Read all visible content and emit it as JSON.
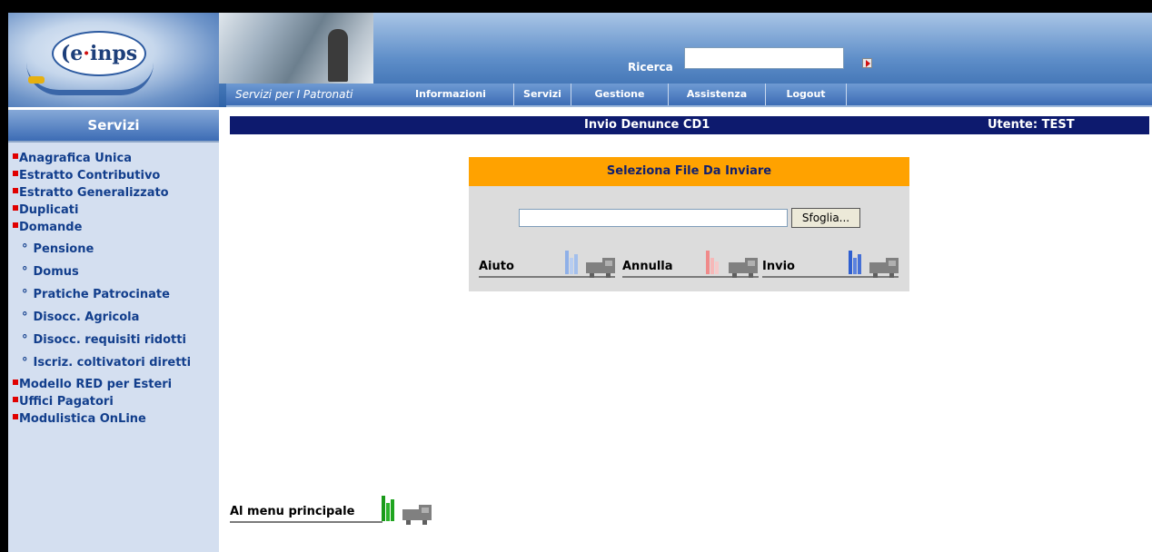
{
  "header": {
    "logo_text": "e-inps",
    "tagline": "Servizi per I Patronati",
    "search_label": "Ricerca",
    "search_value": "",
    "nav": [
      "Informazioni",
      "Servizi",
      "Gestione",
      "Assistenza",
      "Logout"
    ]
  },
  "sidebar": {
    "title": "Servizi",
    "items": [
      {
        "label": "Anagrafica Unica",
        "level": 1
      },
      {
        "label": "Estratto Contributivo",
        "level": 1
      },
      {
        "label": "Estratto Generalizzato",
        "level": 1
      },
      {
        "label": "Duplicati",
        "level": 1
      },
      {
        "label": "Domande",
        "level": 1
      },
      {
        "label": "Pensione",
        "level": 2
      },
      {
        "label": "Domus",
        "level": 2
      },
      {
        "label": "Pratiche Patrocinate",
        "level": 2
      },
      {
        "label": "Disocc. Agricola",
        "level": 2
      },
      {
        "label": "Disocc. requisiti ridotti",
        "level": 2
      },
      {
        "label": "Iscriz. coltivatori diretti",
        "level": 2
      },
      {
        "label": "Modello RED per Esteri",
        "level": 1
      },
      {
        "label": "Uffici Pagatori",
        "level": 1
      },
      {
        "label": "Modulistica OnLine",
        "level": 1
      }
    ]
  },
  "titlebar": {
    "title": "Invio Denunce CD1",
    "user": "Utente: TEST"
  },
  "upload": {
    "heading": "Seleziona File Da Inviare",
    "file_value": "",
    "browse_label": "Sfoglia...",
    "actions": [
      "Aiuto",
      "Annulla",
      "Invio"
    ]
  },
  "footer": {
    "back_label": "Al menu principale"
  },
  "colors": {
    "titlebar": "#0d1a6e",
    "panel_header": "#ffa200",
    "sidebar_bg": "#d4dff0",
    "link": "#123e8c",
    "bullet": "#e00000",
    "aiuto_icon": "#8fb0e8",
    "annulla_icon": "#f08a8a",
    "invio_icon": "#2f5fd0",
    "menu_icon": "#1a9a1a"
  }
}
